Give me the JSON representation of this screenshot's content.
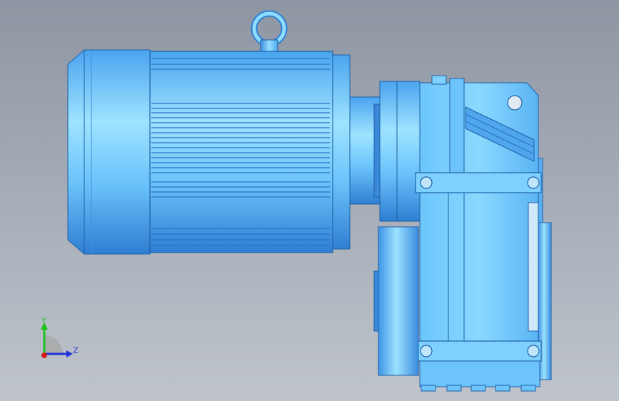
{
  "viewport": {
    "background_top": "#8e96a3",
    "background_bottom": "#bfc4cb"
  },
  "model": {
    "body_color": "#5eb6f5",
    "highlight_color": "#9ee3ff",
    "shadow_color": "#2f7ed2",
    "edge_color": "#1e5fa8"
  },
  "triad": {
    "y_label": "Y",
    "z_label": "Z",
    "y_color": "#19c21e",
    "z_color": "#1e34d8",
    "x_color": "#d21e1e"
  }
}
